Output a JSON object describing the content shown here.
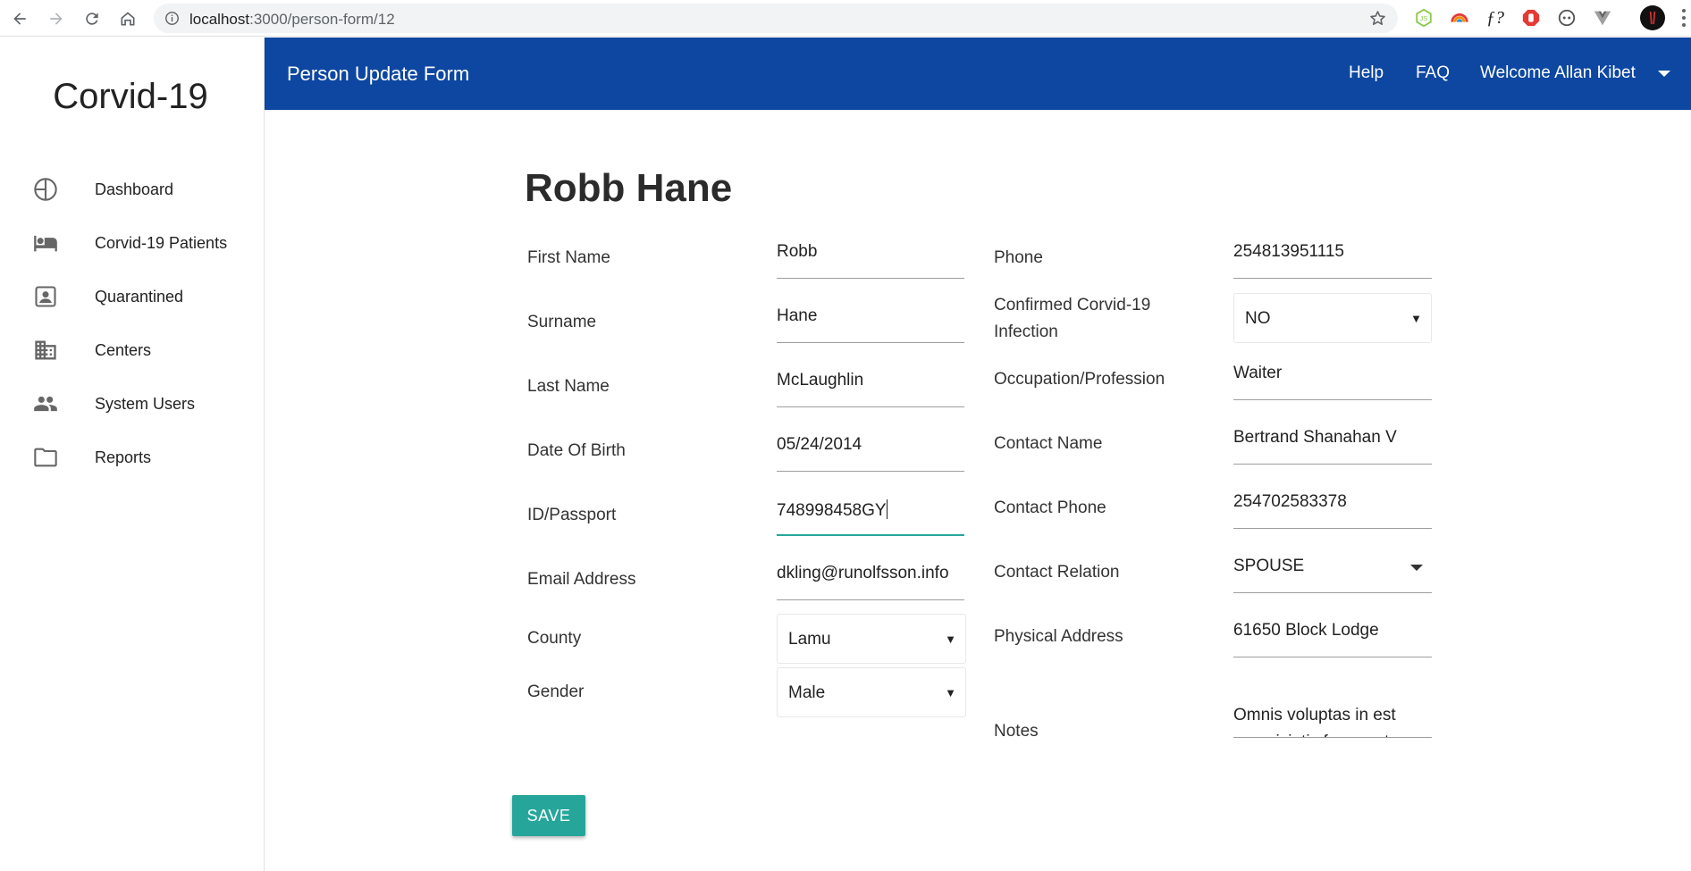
{
  "browser": {
    "url_host": "localhost",
    "url_path": ":3000/person-form/12"
  },
  "sidebar": {
    "brand": "Corvid-19",
    "items": [
      {
        "label": "Dashboard",
        "icon": "pie-chart-icon"
      },
      {
        "label": "Corvid-19 Patients",
        "icon": "hotel-bed-icon"
      },
      {
        "label": "Quarantined",
        "icon": "contact-card-icon"
      },
      {
        "label": "Centers",
        "icon": "business-building-icon"
      },
      {
        "label": "System Users",
        "icon": "people-icon"
      },
      {
        "label": "Reports",
        "icon": "folder-icon"
      }
    ]
  },
  "header": {
    "title": "Person Update Form",
    "help": "Help",
    "faq": "FAQ",
    "welcome": "Welcome Allan Kibet"
  },
  "form": {
    "person_name": "Robb Hane",
    "labels": {
      "first_name": "First Name",
      "surname": "Surname",
      "last_name": "Last Name",
      "dob": "Date Of Birth",
      "id_passport": "ID/Passport",
      "email": "Email Address",
      "county": "County",
      "gender": "Gender",
      "phone": "Phone",
      "confirmed": "Confirmed Corvid-19 Infection",
      "occupation": "Occupation/Profession",
      "contact_name": "Contact Name",
      "contact_phone": "Contact Phone",
      "contact_relation": "Contact Relation",
      "physical_address": "Physical Address",
      "notes": "Notes"
    },
    "values": {
      "first_name": "Robb",
      "surname": "Hane",
      "last_name": "McLaughlin",
      "dob": "05/24/2014",
      "id_passport": "748998458GY",
      "email": "dkling@runolfsson.info",
      "county": "Lamu",
      "gender": "Male",
      "phone": "254813951115",
      "confirmed": "NO",
      "occupation": "Waiter",
      "contact_name": "Bertrand Shanahan V",
      "contact_phone": "254702583378",
      "contact_relation": "SPOUSE",
      "physical_address": "61650 Block Lodge",
      "notes": "Omnis voluptas in est perspiciatis facere et"
    },
    "save_label": "SAVE"
  },
  "colors": {
    "header_bg": "#0d47a1",
    "accent": "#26a69a"
  }
}
